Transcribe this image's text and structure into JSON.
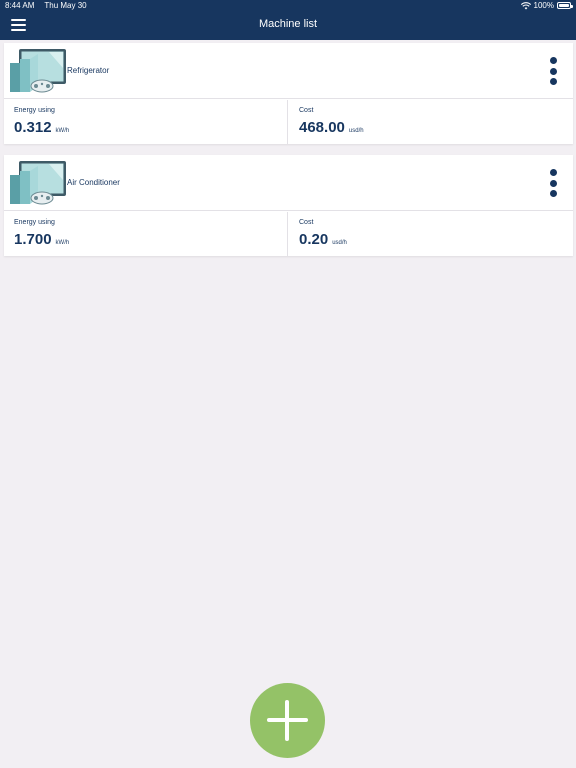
{
  "status_bar": {
    "time": "8:44 AM",
    "date": "Thu May 30",
    "battery": "100%",
    "icons": [
      "wifi-icon",
      "battery-icon"
    ]
  },
  "header": {
    "title": "Machine list",
    "menu_icon": "hamburger-menu-icon"
  },
  "machines": [
    {
      "name": "Refrigerator",
      "icon": "machine-thumbnail-icon",
      "menu_icon": "more-vertical-icon",
      "energy": {
        "label": "Energy using",
        "value": "0.312",
        "unit": "kW/h"
      },
      "cost": {
        "label": "Cost",
        "value": "468.00",
        "unit": "usd/h"
      }
    },
    {
      "name": "Air Conditioner",
      "icon": "machine-thumbnail-icon",
      "menu_icon": "more-vertical-icon",
      "energy": {
        "label": "Energy using",
        "value": "1.700",
        "unit": "kW/h"
      },
      "cost": {
        "label": "Cost",
        "value": "0.20",
        "unit": "usd/h"
      }
    }
  ],
  "fab": {
    "icon": "plus-icon"
  },
  "colors": {
    "header_bg": "#17365f",
    "accent_text": "#17365f",
    "page_bg": "#f2eff3",
    "fab": "#94c267",
    "thumb_frame": "#3e5a66",
    "thumb_screen": "#b7dfe0"
  }
}
